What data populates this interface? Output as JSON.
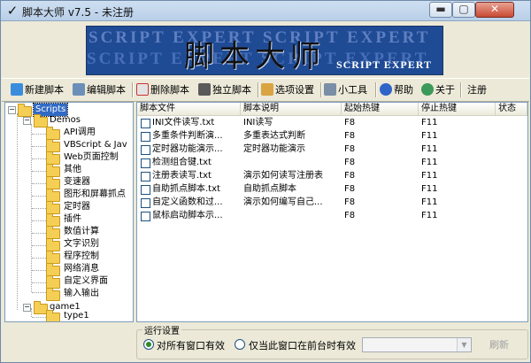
{
  "window": {
    "title": "脚本大师 v7.5 - 未注册",
    "app_icon": "✓"
  },
  "banner": {
    "watermark_line1": "SCRIPT EXPERT SCRIPT EXPERT",
    "watermark_line2": "SCRIPT EXPERT SCRIPT EXPERT",
    "title": "脚本大师",
    "subtitle": "SCRIPT EXPERT"
  },
  "toolbar": {
    "new": "新建脚本",
    "edit": "编辑脚本",
    "delete": "删除脚本",
    "standalone": "独立脚本",
    "options": "选项设置",
    "tools": "小工具",
    "help": "帮助",
    "about": "关于",
    "register": "注册"
  },
  "tree": {
    "root": "Scripts",
    "demos": "Demos",
    "demo_items": [
      "API调用",
      "VBScript & Jav",
      "Web页面控制",
      "其他",
      "变速器",
      "图形和屏幕抓点",
      "定时器",
      "插件",
      "数值计算",
      "文字识别",
      "程序控制",
      "网络消息",
      "自定义界面",
      "输入输出"
    ],
    "game": "game1",
    "game_items": [
      "type1"
    ]
  },
  "list": {
    "columns": [
      "脚本文件",
      "脚本说明",
      "起始热键",
      "停止热键",
      "状态"
    ],
    "rows": [
      {
        "file": "INI文件读写.txt",
        "desc": "INI读写",
        "start": "F8",
        "stop": "F11"
      },
      {
        "file": "多重条件判断演...",
        "desc": "多重表达式判断",
        "start": "F8",
        "stop": "F11"
      },
      {
        "file": "定时器功能演示...",
        "desc": "定时器功能演示",
        "start": "F8",
        "stop": "F11"
      },
      {
        "file": "检测组合键.txt",
        "desc": "",
        "start": "F8",
        "stop": "F11"
      },
      {
        "file": "注册表读写.txt",
        "desc": "演示如何读写注册表",
        "start": "F8",
        "stop": "F11"
      },
      {
        "file": "自助抓点脚本.txt",
        "desc": "自助抓点脚本",
        "start": "F8",
        "stop": "F11"
      },
      {
        "file": "自定义函数和过...",
        "desc": "演示如何编写自己...",
        "start": "F8",
        "stop": "F11"
      },
      {
        "file": "鼠标启动脚本示...",
        "desc": "",
        "start": "F8",
        "stop": "F11"
      }
    ]
  },
  "run_settings": {
    "title": "运行设置",
    "all_windows": "对所有窗口有效",
    "foreground_only": "仅当此窗口在前台时有效",
    "selected": "all_windows",
    "refresh": "刷新"
  }
}
